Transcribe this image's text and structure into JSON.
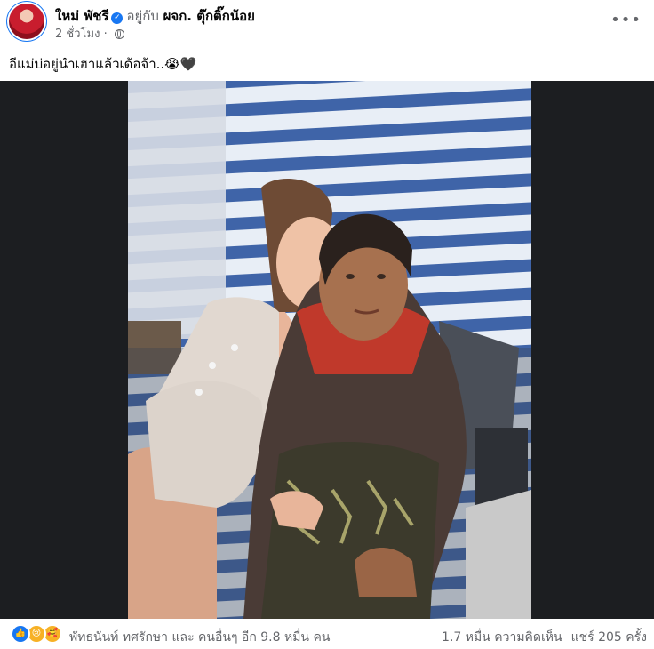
{
  "post": {
    "author_name": "ใหม่ พัชรี",
    "with_label": "อยู่กับ",
    "tagged_page": "ผจก. ตุ๊กติ๊กน้อย",
    "time": "2 ชั่วโมง",
    "separator": "·",
    "caption": "อีแม่บ่อยู่นำเฮาแล้วเด้อจ้า..😭🖤"
  },
  "footer": {
    "reactions_text": "พัทธนันท์ ทศรักษา และ คนอื่นๆ อีก 9.8 หมื่น คน",
    "comments": "1.7 หมื่น ความคิดเห็น",
    "shares": "แชร์ 205 ครั้ง"
  },
  "icons": [
    "verified-badge-icon",
    "globe-icon",
    "more-options-icon",
    "like-reaction-icon",
    "sad-reaction-icon",
    "care-reaction-icon"
  ],
  "colors": {
    "brand_blue": "#1877f2",
    "secondary_text": "#65676b",
    "media_background": "#1c1e21"
  }
}
